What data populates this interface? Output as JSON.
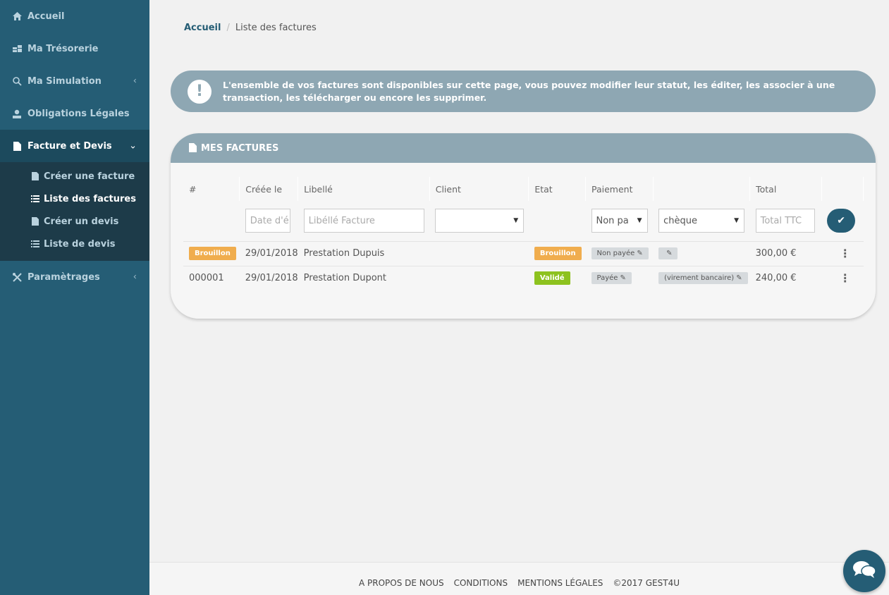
{
  "sidebar": {
    "items": [
      {
        "label": "Accueil",
        "icon": "home-icon"
      },
      {
        "label": "Ma Trésorerie",
        "icon": "coins-icon"
      },
      {
        "label": "Ma Simulation",
        "icon": "search-icon",
        "chevron": "‹"
      },
      {
        "label": "Obligations Légales",
        "icon": "user-icon"
      },
      {
        "label": "Facture et Devis",
        "icon": "document-icon",
        "chevron": "⌄"
      },
      {
        "label": "Paramètrages",
        "icon": "tools-icon",
        "chevron": "‹"
      }
    ],
    "submenu": [
      {
        "label": "Créer une facture",
        "icon": "document-icon"
      },
      {
        "label": "Liste des factures",
        "icon": "list-icon"
      },
      {
        "label": "Créer un devis",
        "icon": "document-icon"
      },
      {
        "label": "Liste de devis",
        "icon": "list-icon"
      }
    ]
  },
  "breadcrumb": {
    "home": "Accueil",
    "separator": "/",
    "current": "Liste des factures"
  },
  "info": {
    "icon": "!",
    "text": "L'ensemble de vos factures sont disponibles sur cette page, vous pouvez modifier leur statut, les éditer, les associer à une transaction, les télécharger ou encore les supprimer."
  },
  "card": {
    "title": "MES FACTURES",
    "columns": [
      "#",
      "Créée le",
      "Libellé",
      "Client",
      "Etat",
      "Paiement",
      "",
      "Total",
      ""
    ],
    "filters": {
      "date_placeholder": "Date d'é",
      "libelle_placeholder": "Libéllé Facture",
      "client_value": "",
      "paiement_value": "Non pa",
      "mode_value": "chèque",
      "total_placeholder": "Total TTC"
    },
    "rows": [
      {
        "num": "Brouillon",
        "num_is_badge": true,
        "date": "29/01/2018",
        "libelle": "Prestation Dupuis",
        "client": "",
        "etat": "Brouillon",
        "paiement": "Non payée",
        "mode": "",
        "total": "300,00 €"
      },
      {
        "num": "000001",
        "num_is_badge": false,
        "date": "29/01/2018",
        "libelle": "Prestation Dupont",
        "client": "",
        "etat": "Validé",
        "paiement": "Payée",
        "mode": "(virement bancaire)",
        "total": "240,00 €"
      }
    ]
  },
  "footer": {
    "links": [
      "A PROPOS DE NOUS",
      "CONDITIONS",
      "MENTIONS LÉGALES",
      "©2017 GEST4U"
    ]
  },
  "colors": {
    "sidebar": "#255d75",
    "accent": "#8ea7b3",
    "draft": "#f0ad4e",
    "valid": "#8dc21f"
  }
}
